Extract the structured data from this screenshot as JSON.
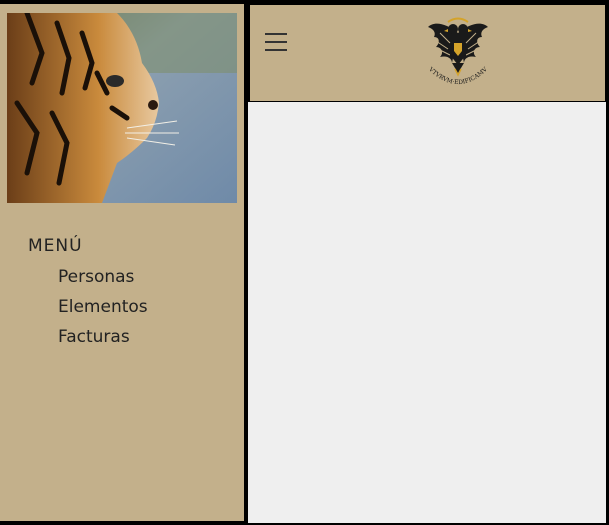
{
  "sidebar": {
    "photo_name": "tiger-portrait",
    "menu_title": "MENÚ",
    "items": [
      {
        "label": "Personas"
      },
      {
        "label": "Elementos"
      },
      {
        "label": "Facturas"
      }
    ]
  },
  "header": {
    "menu_icon": "hamburger-menu-icon",
    "logo_motto": "FVTVRVM·EDIFICAMVS"
  },
  "colors": {
    "panel": "#c3b08b",
    "content": "#efefef",
    "text": "#222222",
    "border": "#000000"
  }
}
